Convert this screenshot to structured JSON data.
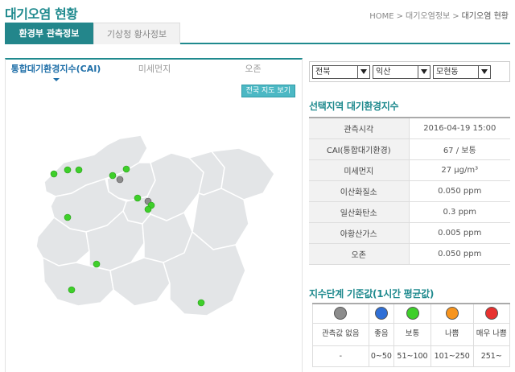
{
  "header": {
    "title": "대기오염 현황",
    "breadcrumb": [
      "HOME",
      "대기오염정보",
      "대기오염 현황"
    ],
    "breadcrumb_sep": ">"
  },
  "main_tabs": [
    {
      "label": "환경부 관측정보",
      "active": true
    },
    {
      "label": "기상청 황사정보",
      "active": false
    }
  ],
  "sub_tabs": [
    {
      "label": "통합대기환경지수(CAI)",
      "active": true
    },
    {
      "label": "미세먼지",
      "active": false
    },
    {
      "label": "오존",
      "active": false
    }
  ],
  "map": {
    "full_map_button": "전국 지도 보기",
    "colors": {
      "good": "#3ecf2a",
      "none": "#8c8c8c",
      "region_fill": "#e3e5e7",
      "region_stroke": "#ffffff"
    }
  },
  "selects": {
    "province": "전북",
    "city": "익산",
    "district": "모현동"
  },
  "selected_region": {
    "title": "선택지역 대기환경지수",
    "rows": [
      {
        "label": "관측시각",
        "value": "2016-04-19 15:00"
      },
      {
        "label": "CAI(통합대기환경)",
        "value": "67 / 보통"
      },
      {
        "label": "미세먼지",
        "value": "27 μg/m³"
      },
      {
        "label": "이산화질소",
        "value": "0.050 ppm"
      },
      {
        "label": "일산화탄소",
        "value": "0.3 ppm"
      },
      {
        "label": "아황산가스",
        "value": "0.005 ppm"
      },
      {
        "label": "오존",
        "value": "0.050 ppm"
      }
    ]
  },
  "scale": {
    "title": "지수단계 기준값(1시간 평균값)",
    "levels": [
      {
        "label": "관측값 없음",
        "range": "-",
        "color": "#8c8c8c"
      },
      {
        "label": "좋음",
        "range": "0~50",
        "color": "#2f6fd6"
      },
      {
        "label": "보통",
        "range": "51~100",
        "color": "#3ecf2a"
      },
      {
        "label": "나쁨",
        "range": "101~250",
        "color": "#f7941d"
      },
      {
        "label": "매우 나쁨",
        "range": "251~",
        "color": "#e8312f"
      }
    ]
  }
}
